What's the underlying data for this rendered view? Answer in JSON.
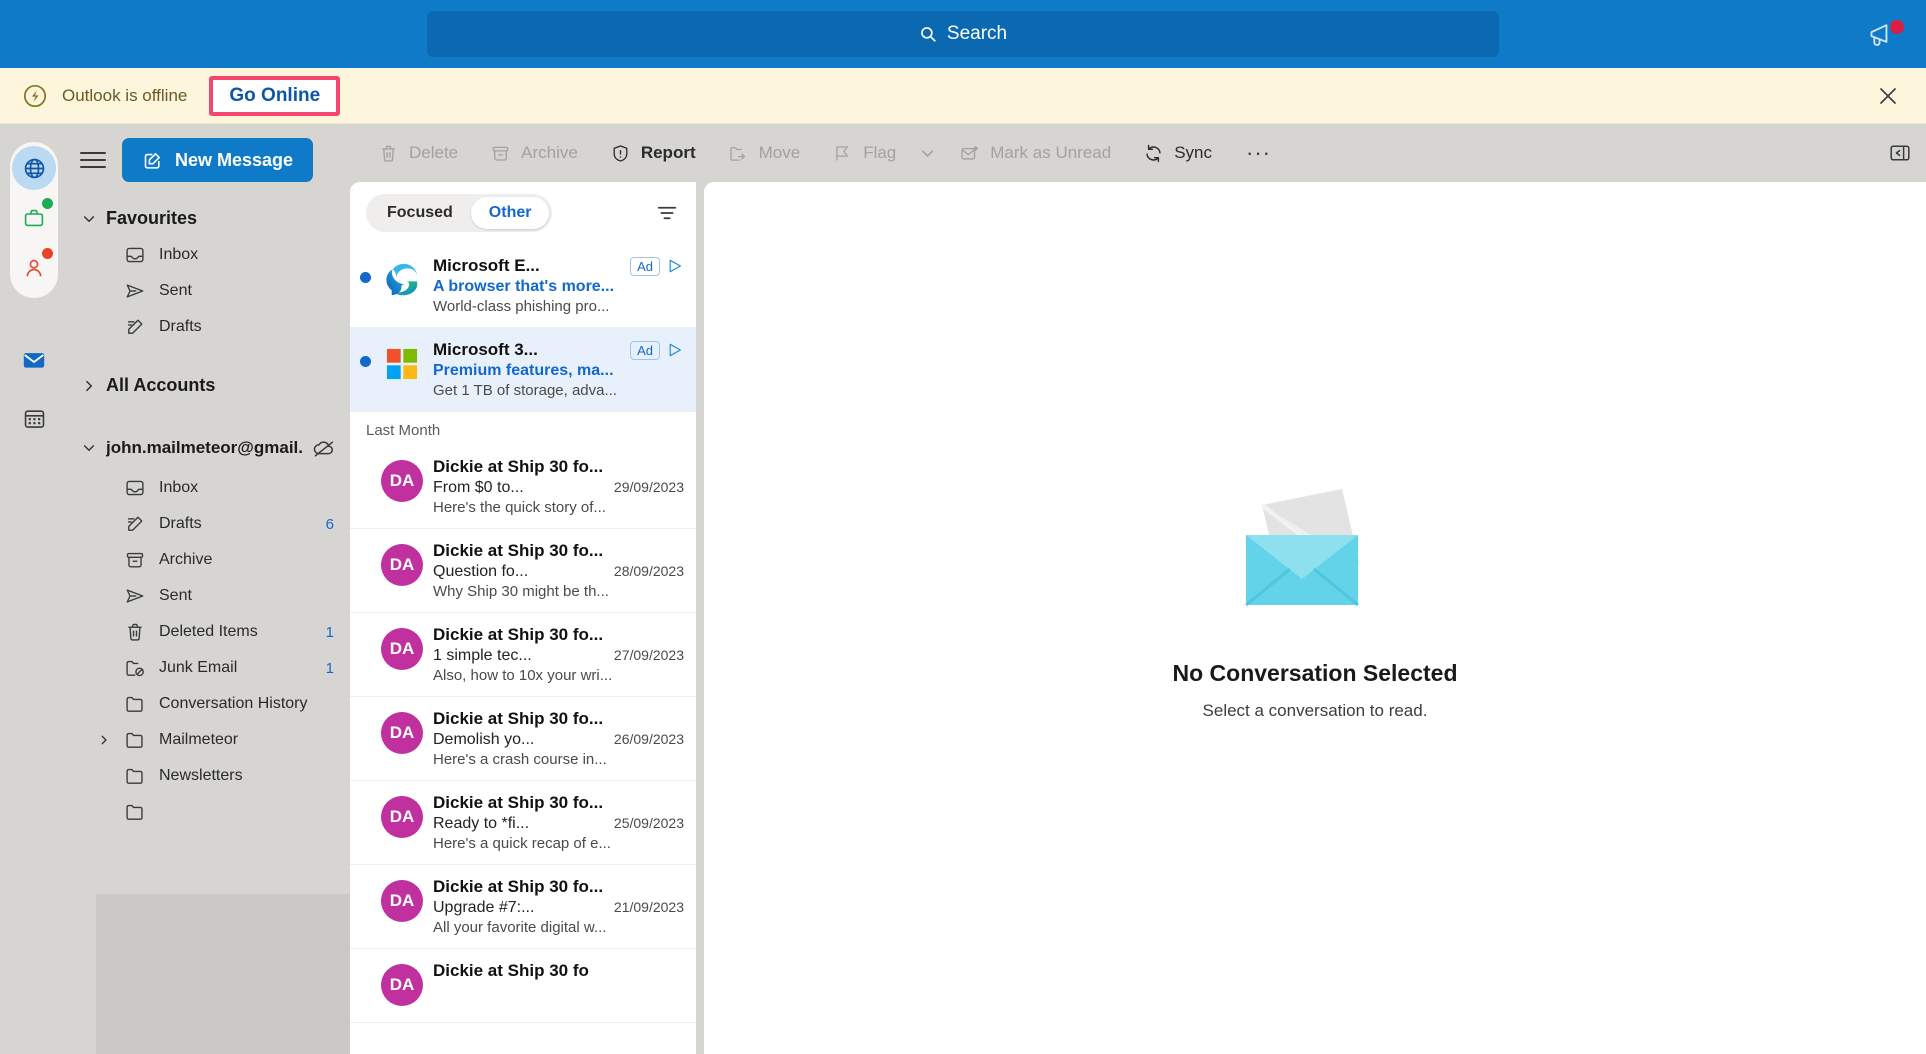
{
  "titlebar": {
    "search_placeholder": "Search",
    "search_icon": "search-icon",
    "announcement_icon": "megaphone-icon"
  },
  "banner": {
    "status_text": "Outlook is offline",
    "action_label": "Go Online",
    "warning_icon": "offline-status-icon",
    "close_icon": "close-icon",
    "highlight_color": "#f6466f",
    "background_color": "#fdf6dd"
  },
  "rail": {
    "items": [
      {
        "name": "globe-icon",
        "label": "Web",
        "active": true,
        "badge": ""
      },
      {
        "name": "briefcase-icon",
        "label": "Work",
        "active": false,
        "badge": "#1faa55"
      },
      {
        "name": "person-icon",
        "label": "Personal",
        "active": false,
        "badge": "#e8442a"
      },
      {
        "name": "mail-icon",
        "label": "Mail",
        "active": false,
        "badge": ""
      },
      {
        "name": "calendar-icon",
        "label": "Calendar",
        "active": false,
        "badge": ""
      }
    ]
  },
  "nav": {
    "menu_icon": "hamburger-icon",
    "new_message_label": "New Message",
    "compose_icon": "compose-icon",
    "favourites": {
      "title": "Favourites",
      "expanded": true,
      "items": [
        {
          "label": "Inbox",
          "icon": "inbox-icon",
          "count": ""
        },
        {
          "label": "Sent",
          "icon": "sent-icon",
          "count": ""
        },
        {
          "label": "Drafts",
          "icon": "drafts-icon",
          "count": ""
        }
      ]
    },
    "all_accounts": {
      "title": "All Accounts",
      "expanded": false
    },
    "account": {
      "name": "john.mailmeteor@gmail...",
      "offline_icon": "cloud-offline-icon",
      "expanded": true,
      "folders": [
        {
          "label": "Inbox",
          "icon": "inbox-icon",
          "count": "",
          "has_children": false
        },
        {
          "label": "Drafts",
          "icon": "drafts-icon",
          "count": "6",
          "has_children": false
        },
        {
          "label": "Archive",
          "icon": "archive-icon",
          "count": "",
          "has_children": false
        },
        {
          "label": "Sent",
          "icon": "sent-icon",
          "count": "",
          "has_children": false
        },
        {
          "label": "Deleted Items",
          "icon": "trash-icon",
          "count": "1",
          "has_children": false
        },
        {
          "label": "Junk Email",
          "icon": "junk-icon",
          "count": "1",
          "has_children": false
        },
        {
          "label": "Conversation History",
          "icon": "folder-icon",
          "count": "",
          "has_children": false
        },
        {
          "label": "Mailmeteor",
          "icon": "folder-icon",
          "count": "",
          "has_children": true
        },
        {
          "label": "Newsletters",
          "icon": "folder-icon",
          "count": "",
          "has_children": false
        }
      ]
    }
  },
  "toolbar": {
    "buttons": [
      {
        "label": "Delete",
        "icon": "trash-icon",
        "state": "disabled",
        "caret": false
      },
      {
        "label": "Archive",
        "icon": "archive-icon",
        "state": "disabled",
        "caret": false
      },
      {
        "label": "Report",
        "icon": "report-shield-icon",
        "state": "enabled",
        "caret": false
      },
      {
        "label": "Move",
        "icon": "move-folder-icon",
        "state": "disabled",
        "caret": false
      },
      {
        "label": "Flag",
        "icon": "flag-icon",
        "state": "disabled",
        "caret": true
      },
      {
        "label": "Mark as Unread",
        "icon": "mark-unread-icon",
        "state": "disabled",
        "caret": false
      },
      {
        "label": "Sync",
        "icon": "sync-icon",
        "state": "enabled-n",
        "caret": false
      }
    ],
    "overflow_label": "···",
    "overflow_icon": "more-options-icon",
    "reading_pane_icon": "reading-pane-icon"
  },
  "message_list": {
    "tabs": [
      {
        "label": "Focused",
        "selected": false
      },
      {
        "label": "Other",
        "selected": true
      }
    ],
    "filter_icon": "filter-icon",
    "groups": [
      {
        "label": "",
        "messages": [
          {
            "sender": "Microsoft E...",
            "subject": "A browser that's more...",
            "preview": "World-class phishing pro...",
            "date": "",
            "unread": true,
            "selected": false,
            "badge": "Ad",
            "has_play": true,
            "avatar_type": "edge-logo",
            "avatar_text": "",
            "avatar_color": "#0f7ac8"
          },
          {
            "sender": "Microsoft 3...",
            "subject": "Premium features, ma...",
            "preview": "Get 1 TB of storage, adva...",
            "date": "",
            "unread": true,
            "selected": true,
            "badge": "Ad",
            "has_play": true,
            "avatar_type": "ms-logo",
            "avatar_text": "",
            "avatar_color": "#0f7ac8"
          }
        ]
      },
      {
        "label": "Last Month",
        "messages": [
          {
            "sender": "Dickie at Ship 30 fo...",
            "subject": "From $0 to...",
            "preview": "Here's the quick story of...",
            "date": "29/09/2023",
            "unread": false,
            "selected": false,
            "badge": "",
            "has_play": false,
            "avatar_type": "initials",
            "avatar_text": "DA",
            "avatar_color": "#c0309f"
          },
          {
            "sender": "Dickie at Ship 30 fo...",
            "subject": "Question fo...",
            "preview": "Why Ship 30 might be th...",
            "date": "28/09/2023",
            "unread": false,
            "selected": false,
            "badge": "",
            "has_play": false,
            "avatar_type": "initials",
            "avatar_text": "DA",
            "avatar_color": "#c0309f"
          },
          {
            "sender": "Dickie at Ship 30 fo...",
            "subject": "1 simple tec...",
            "preview": "Also, how to 10x your wri...",
            "date": "27/09/2023",
            "unread": false,
            "selected": false,
            "badge": "",
            "has_play": false,
            "avatar_type": "initials",
            "avatar_text": "DA",
            "avatar_color": "#c0309f"
          },
          {
            "sender": "Dickie at Ship 30 fo...",
            "subject": "Demolish yo...",
            "preview": "Here's a crash course in...",
            "date": "26/09/2023",
            "unread": false,
            "selected": false,
            "badge": "",
            "has_play": false,
            "avatar_type": "initials",
            "avatar_text": "DA",
            "avatar_color": "#c0309f"
          },
          {
            "sender": "Dickie at Ship 30 fo...",
            "subject": "Ready to *fi...",
            "preview": "Here's a quick recap of e...",
            "date": "25/09/2023",
            "unread": false,
            "selected": false,
            "badge": "",
            "has_play": false,
            "avatar_type": "initials",
            "avatar_text": "DA",
            "avatar_color": "#c0309f"
          },
          {
            "sender": "Dickie at Ship 30 fo...",
            "subject": "Upgrade #7:...",
            "preview": "All your favorite digital w...",
            "date": "21/09/2023",
            "unread": false,
            "selected": false,
            "badge": "",
            "has_play": false,
            "avatar_type": "initials",
            "avatar_text": "DA",
            "avatar_color": "#c0309f"
          },
          {
            "sender": "Dickie at Ship 30 fo",
            "subject": "",
            "preview": "",
            "date": "",
            "unread": false,
            "selected": false,
            "badge": "",
            "has_play": false,
            "avatar_type": "initials",
            "avatar_text": "DA",
            "avatar_color": "#c0309f"
          }
        ]
      }
    ]
  },
  "reading_pane": {
    "empty_title": "No Conversation Selected",
    "empty_subtitle": "Select a conversation to read.",
    "empty_icon": "envelope-illustration"
  }
}
